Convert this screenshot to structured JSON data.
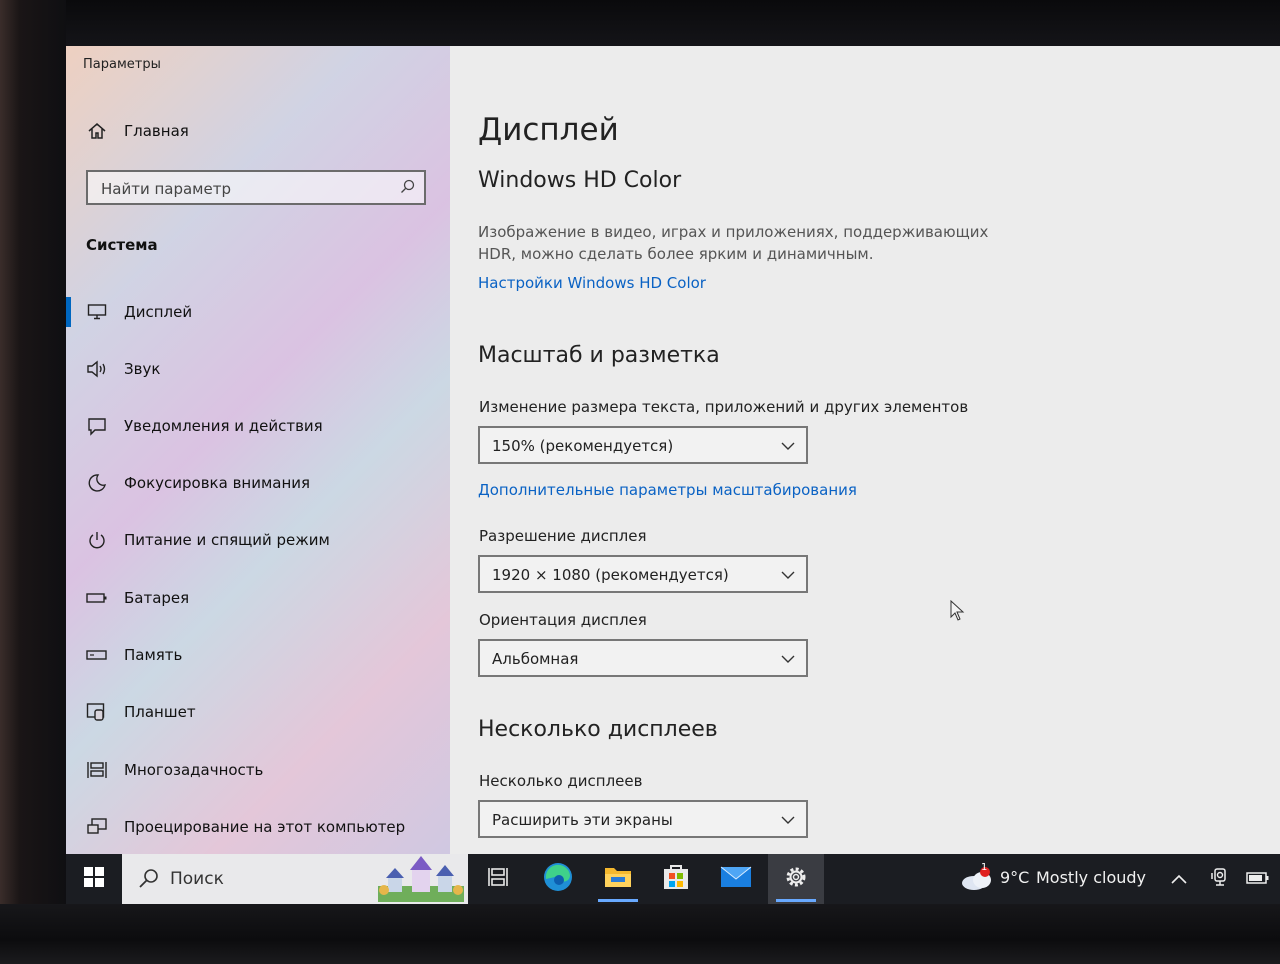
{
  "window": {
    "title": "Параметры"
  },
  "sidebar": {
    "home_label": "Главная",
    "search_placeholder": "Найти параметр",
    "section": "Система",
    "items": [
      {
        "label": "Дисплей",
        "icon": "monitor-icon",
        "selected": true
      },
      {
        "label": "Звук",
        "icon": "speaker-icon"
      },
      {
        "label": "Уведомления и действия",
        "icon": "notification-icon"
      },
      {
        "label": "Фокусировка внимания",
        "icon": "moon-icon"
      },
      {
        "label": "Питание и спящий режим",
        "icon": "power-icon"
      },
      {
        "label": "Батарея",
        "icon": "battery-icon"
      },
      {
        "label": "Память",
        "icon": "storage-icon"
      },
      {
        "label": "Планшет",
        "icon": "tablet-icon"
      },
      {
        "label": "Многозадачность",
        "icon": "multitasking-icon"
      },
      {
        "label": "Проецирование на этот компьютер",
        "icon": "projecting-icon"
      }
    ]
  },
  "main": {
    "title": "Дисплей",
    "hd_color": {
      "heading": "Windows HD Color",
      "description_line1": "Изображение в видео, играх и приложениях, поддерживающих",
      "description_line2": "HDR, можно сделать более ярким и динамичным.",
      "link": "Настройки Windows HD Color"
    },
    "scale": {
      "heading": "Масштаб и разметка",
      "size_label": "Изменение размера текста, приложений и других элементов",
      "size_value": "150% (рекомендуется)",
      "advanced_link": "Дополнительные параметры масштабирования",
      "resolution_label": "Разрешение дисплея",
      "resolution_value": "1920 × 1080 (рекомендуется)",
      "orientation_label": "Ориентация дисплея",
      "orientation_value": "Альбомная"
    },
    "multi": {
      "heading": "Несколько дисплеев",
      "label": "Несколько дисплеев",
      "value": "Расширить эти экраны"
    }
  },
  "taskbar": {
    "search_placeholder": "Поиск",
    "weather_temp": "9°C",
    "weather_desc": "Mostly cloudy",
    "weather_badge": "1",
    "accent": "#68a9ff"
  }
}
